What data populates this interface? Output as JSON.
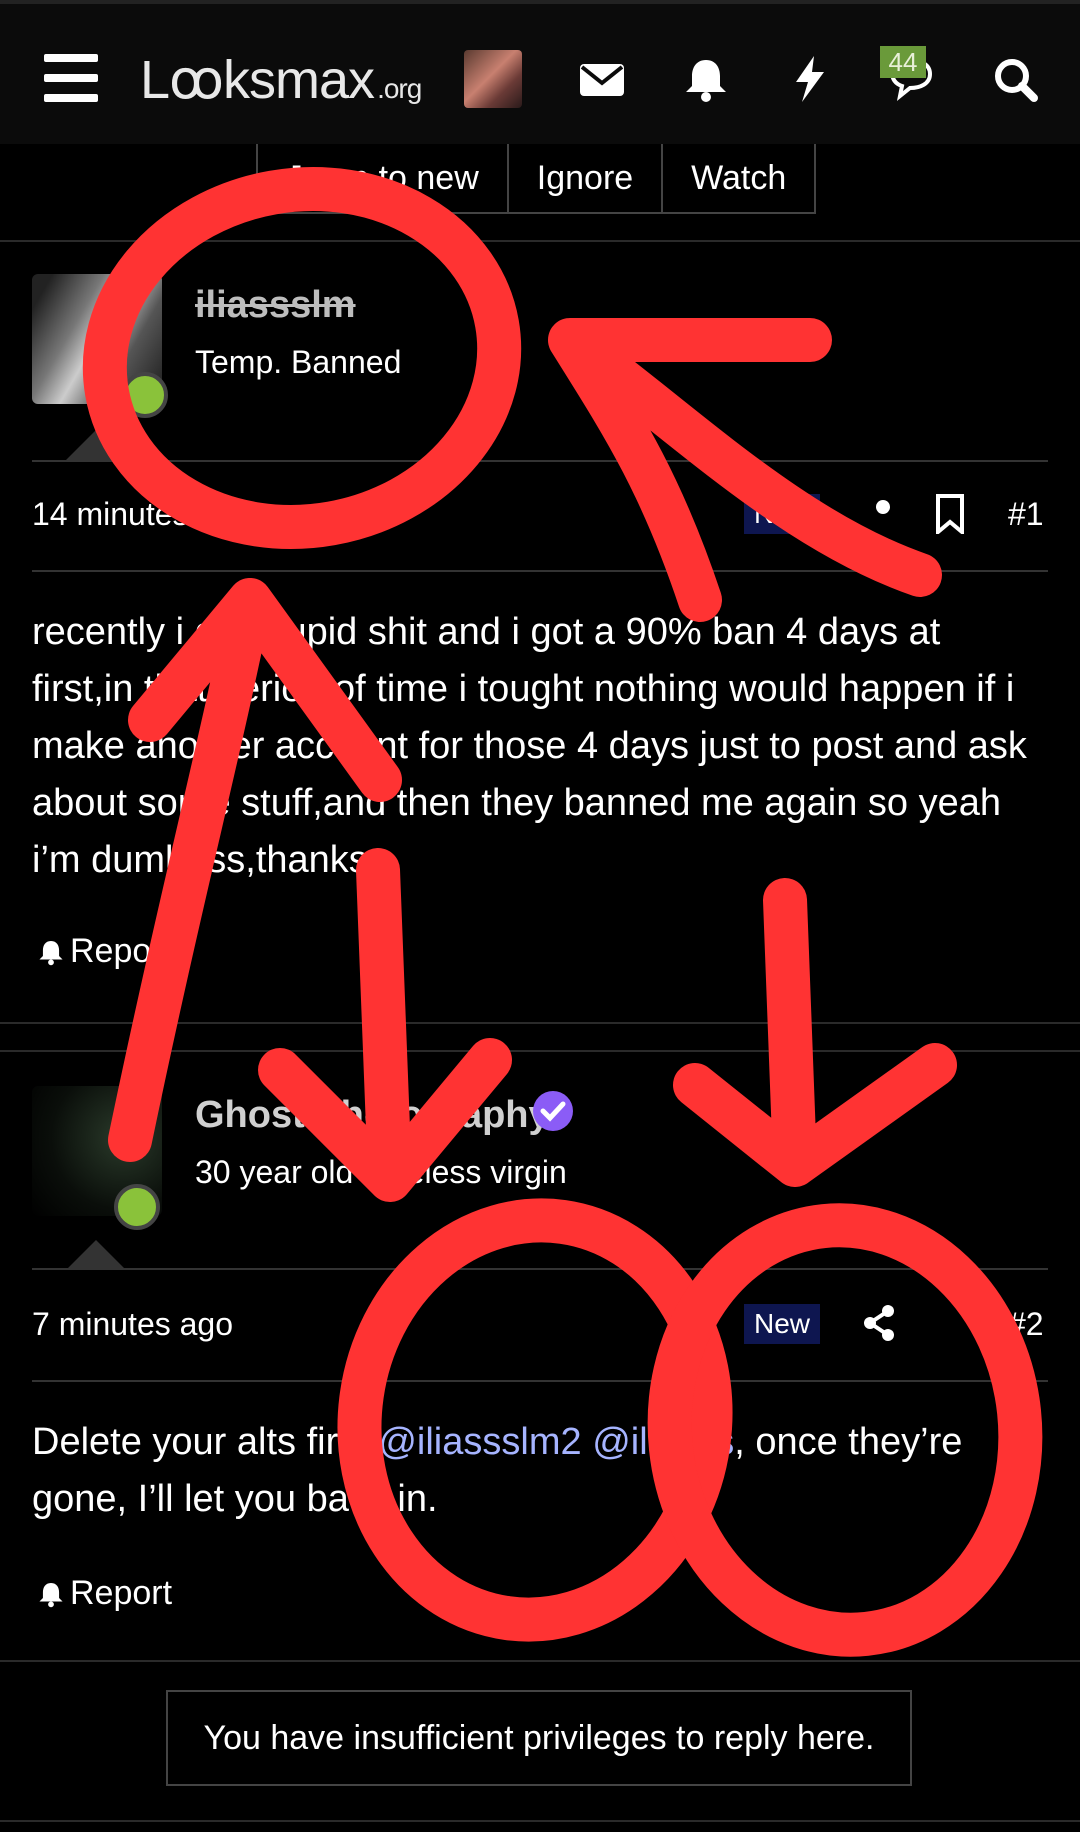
{
  "header": {
    "logo_main": "Lꝏksmax",
    "logo_suffix": ".org",
    "icons": [
      "menu-icon",
      "user-avatar",
      "envelope-icon",
      "bell-icon",
      "bolt-icon",
      "chat-icon",
      "search-icon"
    ],
    "chat_badge": "44"
  },
  "thread_actions": {
    "jump": "Jump to new",
    "ignore": "Ignore",
    "watch": "Watch"
  },
  "posts": [
    {
      "username": "iliassslm",
      "user_title": "Temp. Banned",
      "time": "14 minutes ago",
      "new_label": "New",
      "number": "#1",
      "body": "recently i did stupid shit and i got a 90% ban 4 days at first,in that period of time i tought nothing would happen if i make another account for those 4 days just to post and ask about some stuff,and then they banned me again so yeah i’m dumbass,thanks",
      "report": "Report"
    },
    {
      "username": "Ghost Photography",
      "user_title": "30 year old dateless virgin",
      "time": "7 minutes ago",
      "new_label": "New",
      "number": "#2",
      "body_start": "Delete your alts first ",
      "mention1": "@iliassslm2",
      "body_mid": " ",
      "mention2": "@iliasss",
      "body_end": ", once they’re gone, I’ll let you back in.",
      "report": "Report"
    }
  ],
  "notice": "You have insufficient privileges to reply here.",
  "colors": {
    "annotation": "#ff3333",
    "mention": "#a6b4ff",
    "online": "#8ac23a",
    "verified": "#8b5cf6"
  }
}
